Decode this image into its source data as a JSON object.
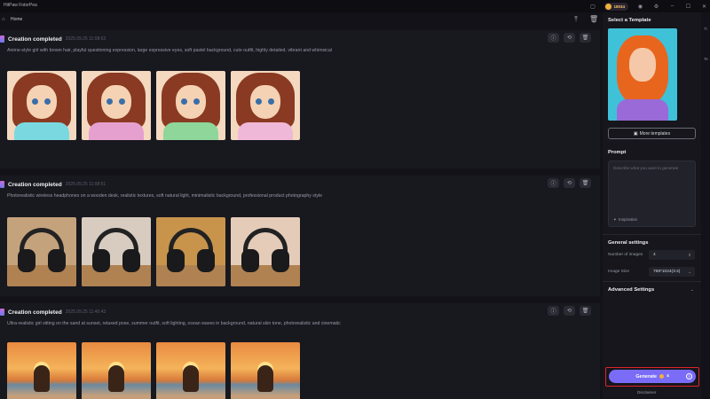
{
  "app": {
    "title": "HitPaw FotorPea",
    "credits": "18034"
  },
  "breadcrumb": {
    "home": "Home"
  },
  "cards": [
    {
      "title": "Creation completed",
      "time": "2025.09.25  11:08:63",
      "prompt": "Anime-style girl with brown hair, playful questioning expression, large expressive eyes, soft pastel background, cute outfit, highly detailed, vibrant and whimsical"
    },
    {
      "title": "Creation completed",
      "time": "2025.09.25  11:08:51",
      "prompt": "Photorealistic wireless headphones on a wooden desk, realistic textures, soft natural light, minimalistic background, professional product photography style"
    },
    {
      "title": "Creation completed",
      "time": "2025.09.25  11:40:43",
      "prompt": "Ultra-realistic girl sitting on the sand at sunset, relaxed pose, summer outfit, soft lighting, ocean waves in background, natural skin tone, photorealistic and cinematic"
    }
  ],
  "sidebar": {
    "select_template": "Select a Template",
    "more_templates": "More templates",
    "prompt_title": "Prompt",
    "prompt_placeholder": "Describe what you want to generate",
    "inspiration": "Inspiration",
    "general_settings": "General settings",
    "num_images_label": "Number of images",
    "num_images_value": "4",
    "image_size_label": "Image Size",
    "image_size_value": "768*1024(3:4)",
    "advanced_settings": "Advanced Settings",
    "generate": "Generate",
    "generate_cost": "4",
    "disclaimer": "Disclaimer"
  },
  "far_right": {
    "label_1": "Ti",
    "label_2": "Te"
  },
  "colors": {
    "accent": "#7a6cf6",
    "highlight_border": "#e0242a",
    "coin": "#f0b23a"
  }
}
